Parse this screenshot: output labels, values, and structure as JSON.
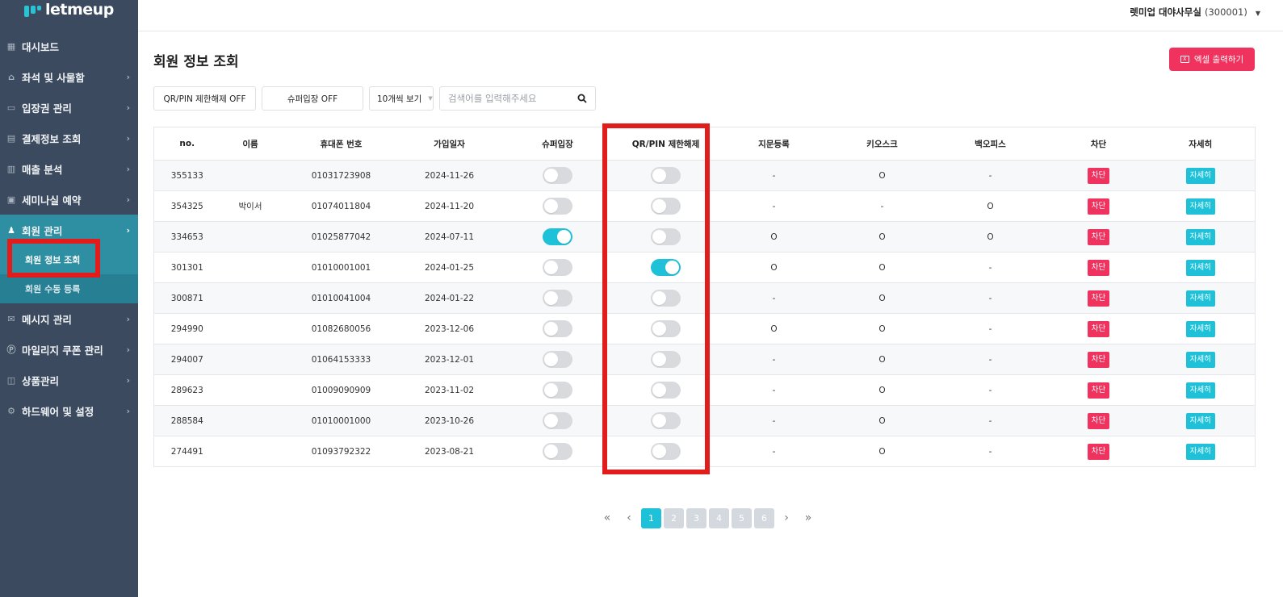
{
  "brand": {
    "name": "letmeup"
  },
  "sidebar": {
    "items": [
      {
        "label": "대시보드",
        "icon": "dashboard-icon",
        "has_children": false
      },
      {
        "label": "좌석 및 사물함",
        "icon": "seat-icon",
        "has_children": true
      },
      {
        "label": "입장권 관리",
        "icon": "ticket-icon",
        "has_children": true
      },
      {
        "label": "결제정보 조회",
        "icon": "card-icon",
        "has_children": true
      },
      {
        "label": "매출 분석",
        "icon": "chart-icon",
        "has_children": true
      },
      {
        "label": "세미나실 예약",
        "icon": "calendar-icon",
        "has_children": true
      },
      {
        "label": "회원 관리",
        "icon": "users-icon",
        "has_children": true,
        "active": true
      },
      {
        "label": "메시지 관리",
        "icon": "mail-icon",
        "has_children": true
      },
      {
        "label": "마일리지 쿠폰 관리",
        "icon": "coupon-icon",
        "has_children": true
      },
      {
        "label": "상품관리",
        "icon": "bag-icon",
        "has_children": true
      },
      {
        "label": "하드웨어 및 설정",
        "icon": "gear-icon",
        "has_children": true
      }
    ],
    "sub_items": [
      {
        "label": "회원 정보 조회",
        "current": true
      },
      {
        "label": "회원 수동 등록",
        "current": false
      }
    ]
  },
  "topbar": {
    "user_name": "렛미업 대야사무실",
    "user_code": "(300001)"
  },
  "page": {
    "title": "회원 정보 조회",
    "excel_button": "엑셀 출력하기"
  },
  "filters": {
    "qr_pin_button": "QR/PIN 제한해제 OFF",
    "super_entry_button": "슈퍼입장 OFF",
    "page_size_select": "10개씩 보기",
    "search_placeholder": "검색어를 입력해주세요"
  },
  "table": {
    "headers": [
      "no.",
      "이름",
      "휴대폰 번호",
      "가입일자",
      "슈퍼입장",
      "QR/PIN 제한해제",
      "지문등록",
      "키오스크",
      "백오피스",
      "차단",
      "자세히"
    ],
    "block_label": "차단",
    "detail_label": "자세히",
    "rows": [
      {
        "no": "355133",
        "name": "",
        "phone": "01031723908",
        "date": "2024-11-26",
        "super": false,
        "qrpin": false,
        "finger": "-",
        "kiosk": "O",
        "backoffice": "-"
      },
      {
        "no": "354325",
        "name": "박이서",
        "phone": "01074011804",
        "date": "2024-11-20",
        "super": false,
        "qrpin": false,
        "finger": "-",
        "kiosk": "-",
        "backoffice": "O"
      },
      {
        "no": "334653",
        "name": "",
        "phone": "01025877042",
        "date": "2024-07-11",
        "super": true,
        "qrpin": false,
        "finger": "O",
        "kiosk": "O",
        "backoffice": "O"
      },
      {
        "no": "301301",
        "name": "",
        "phone": "01010001001",
        "date": "2024-01-25",
        "super": false,
        "qrpin": true,
        "finger": "O",
        "kiosk": "O",
        "backoffice": "-"
      },
      {
        "no": "300871",
        "name": "",
        "phone": "01010041004",
        "date": "2024-01-22",
        "super": false,
        "qrpin": false,
        "finger": "-",
        "kiosk": "O",
        "backoffice": "-"
      },
      {
        "no": "294990",
        "name": "",
        "phone": "01082680056",
        "date": "2023-12-06",
        "super": false,
        "qrpin": false,
        "finger": "O",
        "kiosk": "O",
        "backoffice": "-"
      },
      {
        "no": "294007",
        "name": "",
        "phone": "01064153333",
        "date": "2023-12-01",
        "super": false,
        "qrpin": false,
        "finger": "-",
        "kiosk": "O",
        "backoffice": "-"
      },
      {
        "no": "289623",
        "name": "",
        "phone": "01009090909",
        "date": "2023-11-02",
        "super": false,
        "qrpin": false,
        "finger": "-",
        "kiosk": "O",
        "backoffice": "-"
      },
      {
        "no": "288584",
        "name": "",
        "phone": "01010001000",
        "date": "2023-10-26",
        "super": false,
        "qrpin": false,
        "finger": "-",
        "kiosk": "O",
        "backoffice": "-"
      },
      {
        "no": "274491",
        "name": "",
        "phone": "01093792322",
        "date": "2023-08-21",
        "super": false,
        "qrpin": false,
        "finger": "-",
        "kiosk": "O",
        "backoffice": "-"
      }
    ]
  },
  "pagination": {
    "pages": [
      "1",
      "2",
      "3",
      "4",
      "5",
      "6"
    ],
    "current": "1",
    "first": "«",
    "prev": "‹",
    "next": "›",
    "last": "»"
  },
  "colors": {
    "sidebar_bg": "#3b4a5e",
    "active_teal": "#2e8fa3",
    "accent_cyan": "#1fc1d9",
    "accent_pink": "#f0335e",
    "highlight_red": "#e21b1b"
  }
}
